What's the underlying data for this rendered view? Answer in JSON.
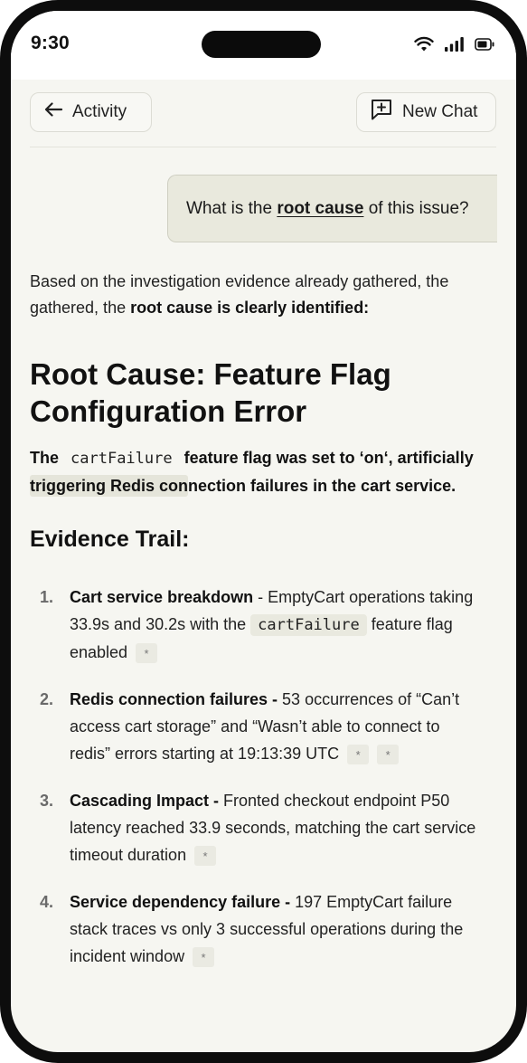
{
  "status": {
    "time": "9:30"
  },
  "header": {
    "back_label": "Activity",
    "new_chat_label": "New Chat"
  },
  "user_message": {
    "before": "What is the ",
    "highlight": "root cause",
    "after": " of this issue?"
  },
  "response": {
    "intro_text": "Based on the investigation evidence already gathered, the gathered, the ",
    "intro_bold": "root cause is clearly identified:",
    "title": "Root Cause: Feature Flag Configuration Error",
    "summary_before": "The ",
    "summary_code": "cartFailure",
    "summary_mid": " feature flag was set to ‘on‘, artificially ",
    "summary_marked": "triggering Redis con",
    "summary_after": "nection failures in the cart service.",
    "evidence_heading": "Evidence Trail:",
    "citation_symbol": "*",
    "items": [
      {
        "num": "1.",
        "bold": "Cart service breakdown",
        "text_before": " - EmptyCart operations taking 33.9s and 30.2s with the ",
        "code": "cartFailure",
        "text_after": " feature flag enabled "
      },
      {
        "num": "2.",
        "bold": "Redis connection failures -",
        "text": " 53 occurrences of “Can’t access cart storage” and “Wasn’t able to connect to redis”  errors starting at 19:13:39 UTC "
      },
      {
        "num": "3.",
        "bold": "Cascading Impact -",
        "text": " Fronted checkout endpoint P50 latency reached 33.9 seconds, matching the cart service timeout duration "
      },
      {
        "num": "4.",
        "bold": "Service dependency failure -",
        "text": " 197 EmptyCart failure stack traces vs only 3 successful operations during the incident window "
      }
    ]
  }
}
